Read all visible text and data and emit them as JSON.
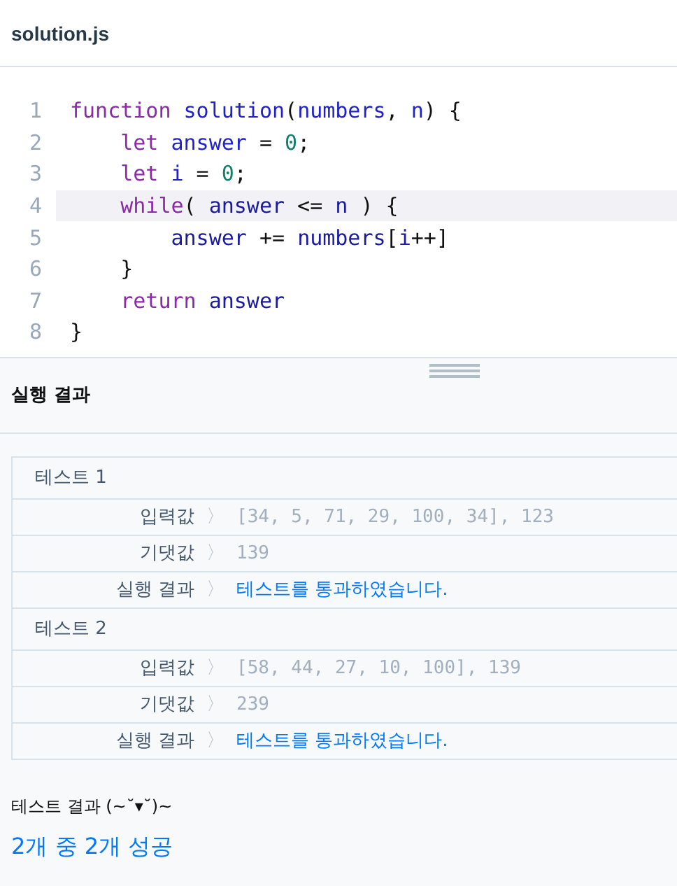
{
  "file_tab": {
    "title": "solution.js"
  },
  "code_lines": [
    {
      "number": "1",
      "highlighted": false,
      "tokens": [
        {
          "kind": "keyword",
          "text": "function"
        },
        {
          "kind": "def",
          "text": " solution"
        },
        {
          "kind": "plain",
          "text": "("
        },
        {
          "kind": "def",
          "text": "numbers"
        },
        {
          "kind": "plain",
          "text": ", "
        },
        {
          "kind": "def",
          "text": "n"
        },
        {
          "kind": "plain",
          "text": ") {"
        }
      ]
    },
    {
      "number": "2",
      "highlighted": false,
      "tokens": [
        {
          "kind": "keyword",
          "text": "    let"
        },
        {
          "kind": "def",
          "text": " answer"
        },
        {
          "kind": "plain",
          "text": " = "
        },
        {
          "kind": "number",
          "text": "0"
        },
        {
          "kind": "plain",
          "text": ";"
        }
      ]
    },
    {
      "number": "3",
      "highlighted": false,
      "tokens": [
        {
          "kind": "keyword",
          "text": "    let"
        },
        {
          "kind": "def",
          "text": " i"
        },
        {
          "kind": "plain",
          "text": " = "
        },
        {
          "kind": "number",
          "text": "0"
        },
        {
          "kind": "plain",
          "text": ";"
        }
      ]
    },
    {
      "number": "4",
      "highlighted": true,
      "tokens": [
        {
          "kind": "keyword",
          "text": "    while"
        },
        {
          "kind": "plain",
          "text": "( "
        },
        {
          "kind": "variable",
          "text": "answer"
        },
        {
          "kind": "plain",
          "text": " <= "
        },
        {
          "kind": "variable",
          "text": "n"
        },
        {
          "kind": "plain",
          "text": " ) {"
        }
      ]
    },
    {
      "number": "5",
      "highlighted": false,
      "tokens": [
        {
          "kind": "variable",
          "text": "        answer"
        },
        {
          "kind": "plain",
          "text": " += "
        },
        {
          "kind": "variable",
          "text": "numbers"
        },
        {
          "kind": "plain",
          "text": "["
        },
        {
          "kind": "variable",
          "text": "i"
        },
        {
          "kind": "plain",
          "text": "++]"
        }
      ]
    },
    {
      "number": "6",
      "highlighted": false,
      "tokens": [
        {
          "kind": "plain",
          "text": "    }"
        }
      ]
    },
    {
      "number": "7",
      "highlighted": false,
      "tokens": [
        {
          "kind": "keyword",
          "text": "    return"
        },
        {
          "kind": "variable",
          "text": " answer"
        }
      ]
    },
    {
      "number": "8",
      "highlighted": false,
      "tokens": [
        {
          "kind": "plain",
          "text": "}"
        }
      ]
    }
  ],
  "results_panel": {
    "title": "실행 결과",
    "tests": [
      {
        "title": "테스트 1",
        "rows": [
          {
            "kind": "value",
            "label": "입력값",
            "arrow": "〉",
            "value": "[34, 5, 71, 29, 100, 34], 123"
          },
          {
            "kind": "value",
            "label": "기댓값",
            "arrow": "〉",
            "value": "139"
          },
          {
            "kind": "result",
            "label": "실행 결과",
            "arrow": "〉",
            "value": "테스트를 통과하였습니다."
          }
        ]
      },
      {
        "title": "테스트 2",
        "rows": [
          {
            "kind": "value",
            "label": "입력값",
            "arrow": "〉",
            "value": "[58, 44, 27, 10, 100], 139"
          },
          {
            "kind": "value",
            "label": "기댓값",
            "arrow": "〉",
            "value": "239"
          },
          {
            "kind": "result",
            "label": "실행 결과",
            "arrow": "〉",
            "value": "테스트를 통과하였습니다."
          }
        ]
      }
    ],
    "summary_title": "테스트 결과 (~˘▾˘)~",
    "summary": "2개 중 2개 성공"
  }
}
